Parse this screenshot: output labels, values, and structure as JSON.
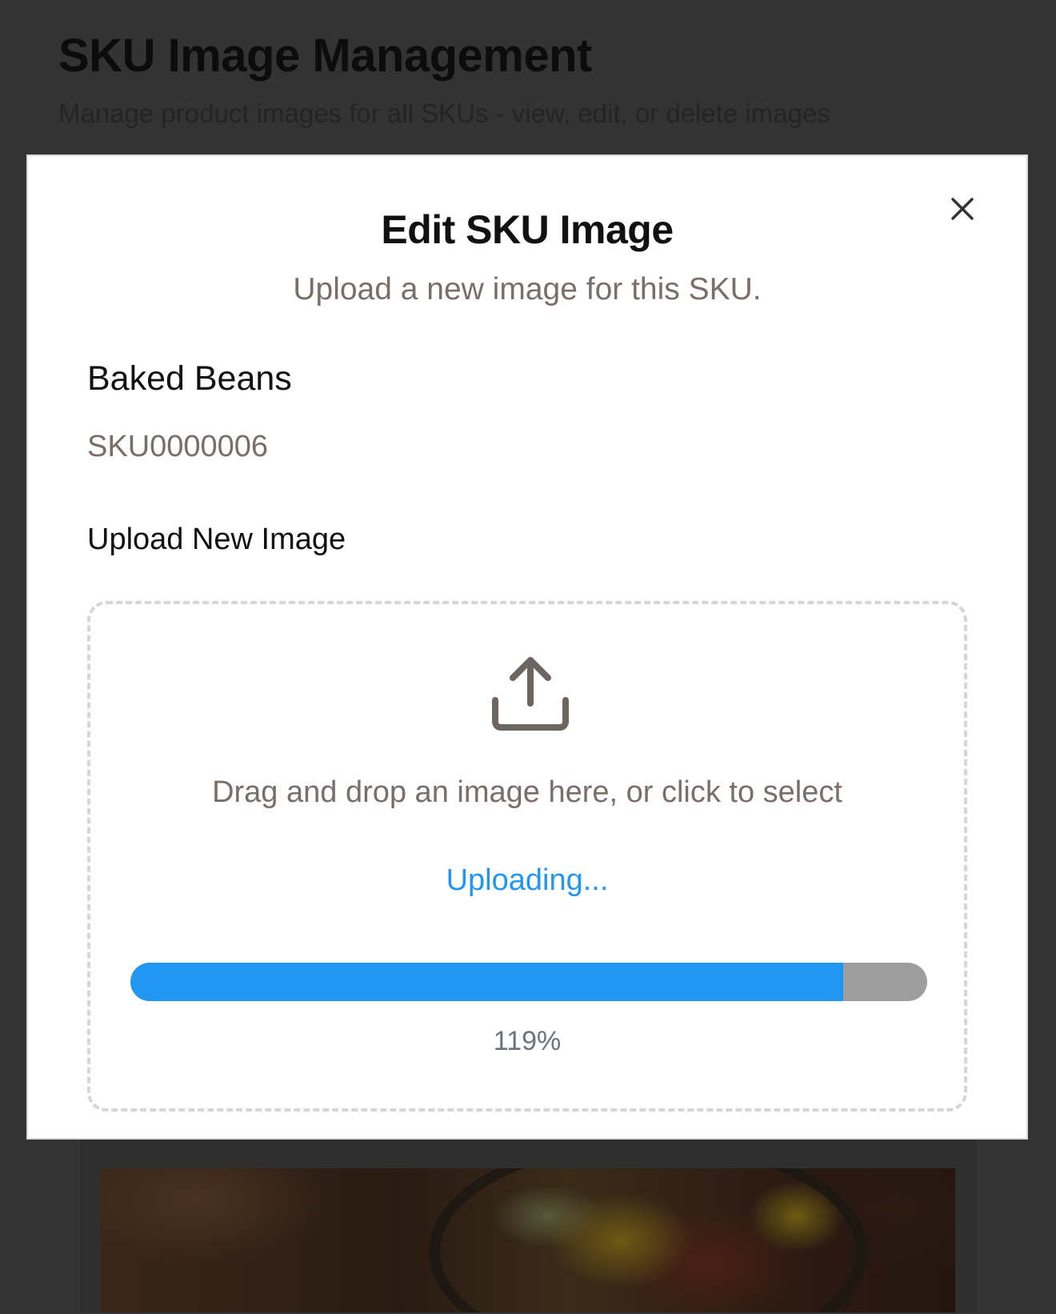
{
  "page": {
    "title": "SKU Image Management",
    "subtitle": "Manage product images for all SKUs - view, edit, or delete images"
  },
  "modal": {
    "title": "Edit SKU Image",
    "description": "Upload a new image for this SKU.",
    "close_icon": "close-icon",
    "product": {
      "name": "Baked Beans",
      "sku": "SKU0000006"
    },
    "upload": {
      "label": "Upload New Image",
      "icon": "upload-icon",
      "drop_text": "Drag and drop an image here, or click to select",
      "status": "Uploading...",
      "progress_percent_text": "119%",
      "progress_bar_fill_fraction": 0.895
    }
  },
  "colors": {
    "accent": "#2196f3",
    "progress_track": "#9e9e9e",
    "overlay": "#333333",
    "muted_text": "#7a6e68"
  }
}
